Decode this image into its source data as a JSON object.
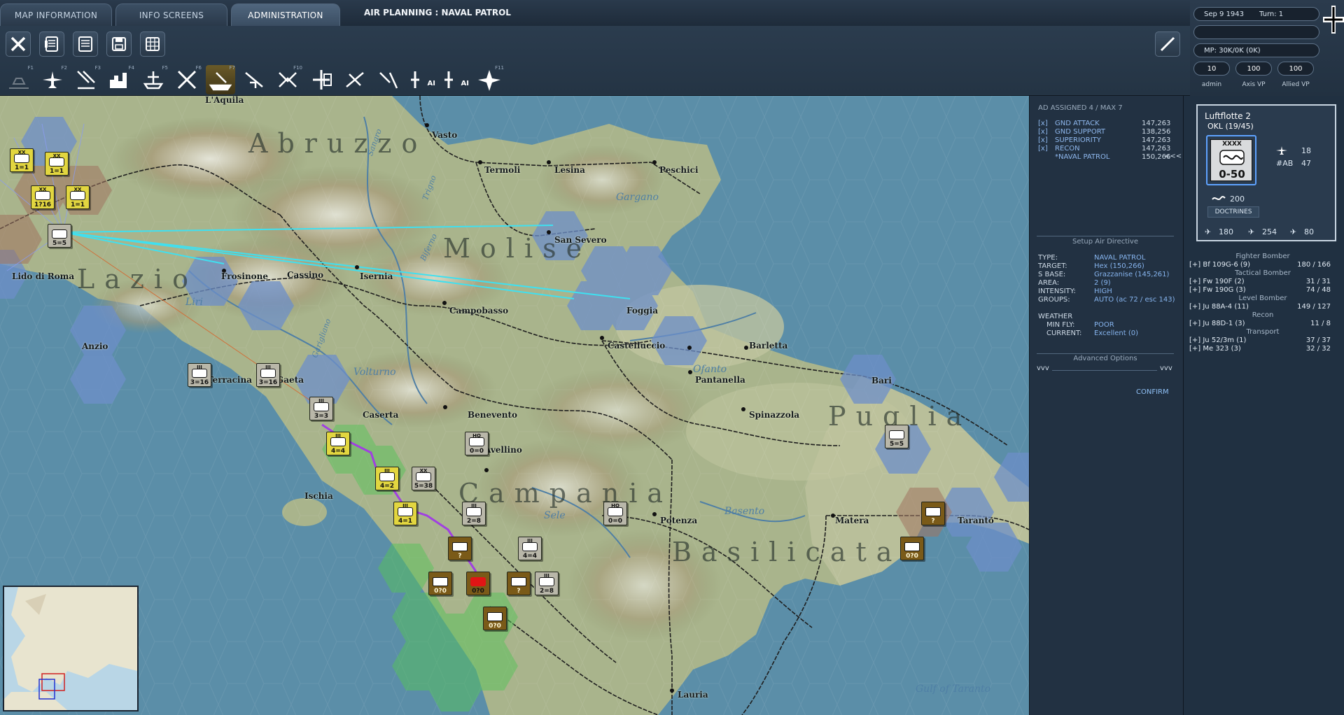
{
  "tabs": [
    {
      "label": "MAP INFORMATION"
    },
    {
      "label": "INFO SCREENS"
    },
    {
      "label": "ADMINISTRATION"
    }
  ],
  "window_title": "AIR PLANNING : NAVAL PATROL",
  "toolbar": {
    "tools": [
      "close-icon",
      "list-detail-icon",
      "list-icon",
      "save-icon",
      "grid-icon"
    ],
    "air_missions": [
      {
        "key": "F1",
        "icon": "air-base-icon",
        "state": "disabled"
      },
      {
        "key": "F2",
        "icon": "air-transport-icon",
        "state": "normal"
      },
      {
        "key": "F3",
        "icon": "ground-attack-icon",
        "state": "normal"
      },
      {
        "key": "F4",
        "icon": "city-attack-icon",
        "state": "normal"
      },
      {
        "key": "F5",
        "icon": "port-attack-icon",
        "state": "normal"
      },
      {
        "key": "F6",
        "icon": "interdiction-icon",
        "state": "normal"
      },
      {
        "key": "F7",
        "icon": "naval-patrol-icon",
        "state": "active"
      },
      {
        "key": "",
        "icon": "recon-icon",
        "state": "normal"
      },
      {
        "key": "F10",
        "icon": "escort-icon",
        "state": "normal"
      },
      {
        "key": "",
        "icon": "air-superiority-icon",
        "state": "normal"
      },
      {
        "key": "",
        "icon": "air-supply-icon",
        "state": "normal"
      },
      {
        "key": "",
        "icon": "transfer-icon",
        "state": "normal"
      },
      {
        "key": "",
        "icon": "ai-air-icon",
        "state": "normal",
        "label": "AI"
      },
      {
        "key": "",
        "icon": "ai-air-plus-icon",
        "state": "normal",
        "label": "AI"
      },
      {
        "key": "F11",
        "icon": "bombardment-icon",
        "state": "normal"
      }
    ]
  },
  "status": {
    "date": "Sep 9 1943",
    "turn": "Turn: 1",
    "mp": "MP:  30K/0K (0K)",
    "admin_value": "10",
    "axis_vp": "100",
    "allied_vp": "100",
    "admin_label": "admin",
    "axis_label": "Axis VP",
    "allied_label": "Allied VP"
  },
  "map": {
    "places": [
      {
        "name": "L'Aquila"
      },
      {
        "name": "Vasto"
      },
      {
        "name": "Termoli"
      },
      {
        "name": "Lesina"
      },
      {
        "name": "Peschici"
      },
      {
        "name": "San Severo"
      },
      {
        "name": "Frosinone"
      },
      {
        "name": "Cassino"
      },
      {
        "name": "Isernia"
      },
      {
        "name": "Lido di Roma"
      },
      {
        "name": "Campobasso"
      },
      {
        "name": "Foggia"
      },
      {
        "name": "Anzio"
      },
      {
        "name": "Castelluccio"
      },
      {
        "name": "Barletta"
      },
      {
        "name": "Pantanella"
      },
      {
        "name": "Bari"
      },
      {
        "name": "Terracina"
      },
      {
        "name": "Gaeta"
      },
      {
        "name": "Caserta"
      },
      {
        "name": "Benevento"
      },
      {
        "name": "Spinazzola"
      },
      {
        "name": "Avellino"
      },
      {
        "name": "Ischia"
      },
      {
        "name": "Potenza"
      },
      {
        "name": "Matera"
      },
      {
        "name": "Taranto"
      },
      {
        "name": "Lauria"
      }
    ],
    "regions": [
      "Abruzzo",
      "Molise",
      "Lazio",
      "Campania",
      "Puglia",
      "Basilicata"
    ],
    "geo_labels": [
      "Gargano",
      "Liri",
      "Volturno",
      "Ofanto",
      "Sele",
      "Basento",
      "Gulf of Taranto",
      "Sangro",
      "Trigno",
      "Biferno",
      "Garigliano"
    ]
  },
  "air_planning": {
    "header": "AD ASSIGNED 4 / MAX 7",
    "missions": [
      {
        "check": "[x]",
        "name": "GND ATTACK",
        "coords": "147,263"
      },
      {
        "check": "[x]",
        "name": "GND SUPPORT",
        "coords": "138,256"
      },
      {
        "check": "[x]",
        "name": "SUPERIORITY",
        "coords": "147,263"
      },
      {
        "check": "[x]",
        "name": "RECON",
        "coords": "147,263"
      },
      {
        "check": "",
        "name": "*NAVAL PATROL",
        "coords": "150,266"
      }
    ],
    "collapse_label": "<<<",
    "setup_title": "Setup Air Directive",
    "details": [
      {
        "key": "TYPE:",
        "value": "NAVAL PATROL"
      },
      {
        "key": "TARGET:",
        "value": "Hex (150,266)"
      },
      {
        "key": "S BASE:",
        "value": "Grazzanise (145,261)"
      },
      {
        "key": "AREA:",
        "value": "2 (9)"
      },
      {
        "key": "INTENSITY:",
        "value": "HIGH"
      },
      {
        "key": "GROUPS:",
        "value": "AUTO (ac 72 / esc 143)"
      }
    ],
    "weather_title": "WEATHER",
    "weather": [
      {
        "key": "MIN FLY:",
        "value": "POOR"
      },
      {
        "key": "CURRENT:",
        "value": "Excellent (0)"
      }
    ],
    "advanced_title": "Advanced Options",
    "adv_left": "vvv",
    "adv_right": "vvv",
    "confirm": "CONFIRM"
  },
  "unit_panel": {
    "name": "Luftflotte 2",
    "hq": "OKL  (19/45)",
    "echelon": "XXXX",
    "counter_value": "0-50",
    "aircraft_count": "18",
    "ab_label": "#AB",
    "ab_value": "47",
    "support": "200",
    "doctrines": "DOCTRINES",
    "fighters": "180",
    "bombers": "254",
    "transports": "80",
    "groups": [
      {
        "type": "header",
        "label": "Fighter Bomber"
      },
      {
        "type": "row",
        "name": "[+] Bf 109G-6 (9)",
        "value": "180 / 166"
      },
      {
        "type": "header",
        "label": "Tactical Bomber"
      },
      {
        "type": "row",
        "name": "[+] Fw 190F (2)",
        "value": "31 / 31"
      },
      {
        "type": "row",
        "name": "[+] Fw 190G (3)",
        "value": "74 / 48"
      },
      {
        "type": "header",
        "label": "Level Bomber"
      },
      {
        "type": "row",
        "name": "[+] Ju 88A-4 (11)",
        "value": "149 / 127"
      },
      {
        "type": "header",
        "label": "Recon"
      },
      {
        "type": "row",
        "name": "[+] Ju 88D-1 (3)",
        "value": "11 / 8"
      },
      {
        "type": "header",
        "label": "Transport"
      },
      {
        "type": "row",
        "name": "[+] Ju 52/3m (1)",
        "value": "37 / 37"
      },
      {
        "type": "row",
        "name": "[+] Me 323 (3)",
        "value": "32 / 32"
      }
    ]
  },
  "units": [
    {
      "label": "1=1",
      "ech": "XX",
      "style": "yel"
    },
    {
      "label": "1=1",
      "ech": "XX",
      "style": "yel"
    },
    {
      "label": "1?16",
      "ech": "XX",
      "style": "yel"
    },
    {
      "label": "1=1",
      "ech": "XX",
      "style": "yel"
    },
    {
      "label": "5=5",
      "ech": "",
      "style": "gry"
    },
    {
      "label": "3=16",
      "ech": "III",
      "style": "gry"
    },
    {
      "label": "3=16",
      "ech": "III",
      "style": "gry"
    },
    {
      "label": "3=3",
      "ech": "III",
      "style": "gry"
    },
    {
      "label": "4=4",
      "ech": "III",
      "style": "yel"
    },
    {
      "label": "0=0",
      "ech": "HQ",
      "style": "gry"
    },
    {
      "label": "4=2",
      "ech": "III",
      "style": "yel"
    },
    {
      "label": "5=38",
      "ech": "XX",
      "style": "gry"
    },
    {
      "label": "4=1",
      "ech": "III",
      "style": "yel"
    },
    {
      "label": "2=8",
      "ech": "III",
      "style": "gry"
    },
    {
      "label": "0=0",
      "ech": "HQ",
      "style": "gry"
    },
    {
      "label": "4=4",
      "ech": "III",
      "style": "gry"
    },
    {
      "label": "?",
      "ech": "",
      "style": "brn"
    },
    {
      "label": "0?0",
      "ech": "",
      "style": "brn"
    },
    {
      "label": "0?0",
      "ech": "",
      "style": "red"
    },
    {
      "label": "?",
      "ech": "",
      "style": "brn"
    },
    {
      "label": "2=8",
      "ech": "III",
      "style": "gry"
    },
    {
      "label": "0?0",
      "ech": "",
      "style": "brn"
    },
    {
      "label": "5=5",
      "ech": "",
      "style": "gry"
    },
    {
      "label": "?",
      "ech": "",
      "style": "brn"
    },
    {
      "label": "0?0",
      "ech": "",
      "style": "brn"
    }
  ]
}
